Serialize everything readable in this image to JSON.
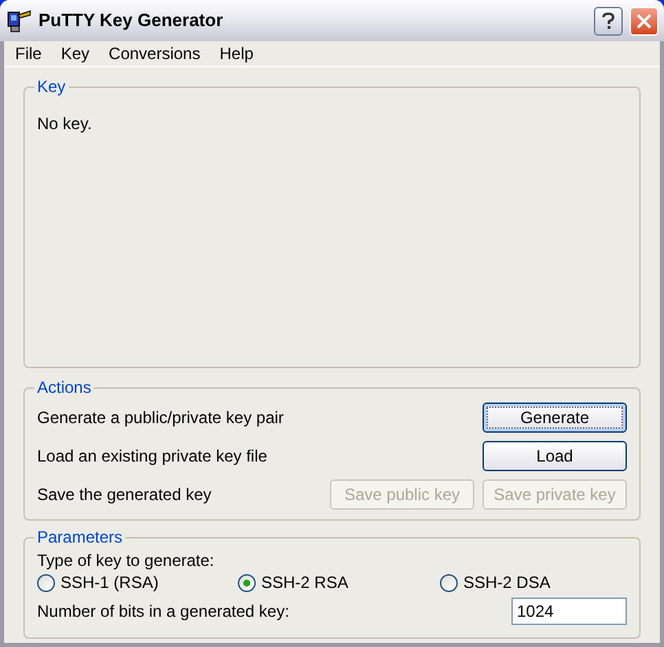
{
  "window": {
    "title": "PuTTY Key Generator"
  },
  "menu": [
    "File",
    "Key",
    "Conversions",
    "Help"
  ],
  "key_group": {
    "title": "Key",
    "text": "No key."
  },
  "actions": {
    "title": "Actions",
    "rows": [
      {
        "label": "Generate a public/private key pair",
        "buttons": [
          {
            "label": "Generate",
            "disabled": false,
            "focused": true
          }
        ]
      },
      {
        "label": "Load an existing private key file",
        "buttons": [
          {
            "label": "Load",
            "disabled": false,
            "focused": false
          }
        ]
      },
      {
        "label": "Save the generated key",
        "buttons": [
          {
            "label": "Save public key",
            "disabled": true,
            "focused": false
          },
          {
            "label": "Save private key",
            "disabled": true,
            "focused": false
          }
        ]
      }
    ]
  },
  "parameters": {
    "title": "Parameters",
    "type_label": "Type of key to generate:",
    "options": [
      {
        "label": "SSH-1 (RSA)",
        "selected": false
      },
      {
        "label": "SSH-2 RSA",
        "selected": true
      },
      {
        "label": "SSH-2 DSA",
        "selected": false
      }
    ],
    "bits_label": "Number of bits in a generated key:",
    "bits_value": "1024"
  }
}
